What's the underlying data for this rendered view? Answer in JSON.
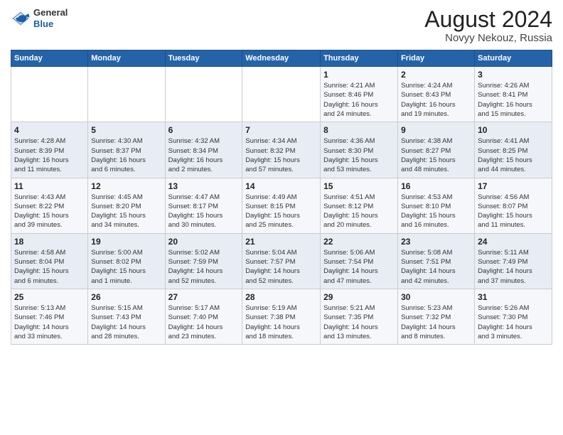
{
  "header": {
    "logo_general": "General",
    "logo_blue": "Blue",
    "month_year": "August 2024",
    "location": "Novyy Nekouz, Russia"
  },
  "days_of_week": [
    "Sunday",
    "Monday",
    "Tuesday",
    "Wednesday",
    "Thursday",
    "Friday",
    "Saturday"
  ],
  "weeks": [
    [
      {
        "day": "",
        "info": ""
      },
      {
        "day": "",
        "info": ""
      },
      {
        "day": "",
        "info": ""
      },
      {
        "day": "",
        "info": ""
      },
      {
        "day": "1",
        "info": "Sunrise: 4:21 AM\nSunset: 8:46 PM\nDaylight: 16 hours\nand 24 minutes."
      },
      {
        "day": "2",
        "info": "Sunrise: 4:24 AM\nSunset: 8:43 PM\nDaylight: 16 hours\nand 19 minutes."
      },
      {
        "day": "3",
        "info": "Sunrise: 4:26 AM\nSunset: 8:41 PM\nDaylight: 16 hours\nand 15 minutes."
      }
    ],
    [
      {
        "day": "4",
        "info": "Sunrise: 4:28 AM\nSunset: 8:39 PM\nDaylight: 16 hours\nand 11 minutes."
      },
      {
        "day": "5",
        "info": "Sunrise: 4:30 AM\nSunset: 8:37 PM\nDaylight: 16 hours\nand 6 minutes."
      },
      {
        "day": "6",
        "info": "Sunrise: 4:32 AM\nSunset: 8:34 PM\nDaylight: 16 hours\nand 2 minutes."
      },
      {
        "day": "7",
        "info": "Sunrise: 4:34 AM\nSunset: 8:32 PM\nDaylight: 15 hours\nand 57 minutes."
      },
      {
        "day": "8",
        "info": "Sunrise: 4:36 AM\nSunset: 8:30 PM\nDaylight: 15 hours\nand 53 minutes."
      },
      {
        "day": "9",
        "info": "Sunrise: 4:38 AM\nSunset: 8:27 PM\nDaylight: 15 hours\nand 48 minutes."
      },
      {
        "day": "10",
        "info": "Sunrise: 4:41 AM\nSunset: 8:25 PM\nDaylight: 15 hours\nand 44 minutes."
      }
    ],
    [
      {
        "day": "11",
        "info": "Sunrise: 4:43 AM\nSunset: 8:22 PM\nDaylight: 15 hours\nand 39 minutes."
      },
      {
        "day": "12",
        "info": "Sunrise: 4:45 AM\nSunset: 8:20 PM\nDaylight: 15 hours\nand 34 minutes."
      },
      {
        "day": "13",
        "info": "Sunrise: 4:47 AM\nSunset: 8:17 PM\nDaylight: 15 hours\nand 30 minutes."
      },
      {
        "day": "14",
        "info": "Sunrise: 4:49 AM\nSunset: 8:15 PM\nDaylight: 15 hours\nand 25 minutes."
      },
      {
        "day": "15",
        "info": "Sunrise: 4:51 AM\nSunset: 8:12 PM\nDaylight: 15 hours\nand 20 minutes."
      },
      {
        "day": "16",
        "info": "Sunrise: 4:53 AM\nSunset: 8:10 PM\nDaylight: 15 hours\nand 16 minutes."
      },
      {
        "day": "17",
        "info": "Sunrise: 4:56 AM\nSunset: 8:07 PM\nDaylight: 15 hours\nand 11 minutes."
      }
    ],
    [
      {
        "day": "18",
        "info": "Sunrise: 4:58 AM\nSunset: 8:04 PM\nDaylight: 15 hours\nand 6 minutes."
      },
      {
        "day": "19",
        "info": "Sunrise: 5:00 AM\nSunset: 8:02 PM\nDaylight: 15 hours\nand 1 minute."
      },
      {
        "day": "20",
        "info": "Sunrise: 5:02 AM\nSunset: 7:59 PM\nDaylight: 14 hours\nand 52 minutes."
      },
      {
        "day": "21",
        "info": "Sunrise: 5:04 AM\nSunset: 7:57 PM\nDaylight: 14 hours\nand 52 minutes."
      },
      {
        "day": "22",
        "info": "Sunrise: 5:06 AM\nSunset: 7:54 PM\nDaylight: 14 hours\nand 47 minutes."
      },
      {
        "day": "23",
        "info": "Sunrise: 5:08 AM\nSunset: 7:51 PM\nDaylight: 14 hours\nand 42 minutes."
      },
      {
        "day": "24",
        "info": "Sunrise: 5:11 AM\nSunset: 7:49 PM\nDaylight: 14 hours\nand 37 minutes."
      }
    ],
    [
      {
        "day": "25",
        "info": "Sunrise: 5:13 AM\nSunset: 7:46 PM\nDaylight: 14 hours\nand 33 minutes."
      },
      {
        "day": "26",
        "info": "Sunrise: 5:15 AM\nSunset: 7:43 PM\nDaylight: 14 hours\nand 28 minutes."
      },
      {
        "day": "27",
        "info": "Sunrise: 5:17 AM\nSunset: 7:40 PM\nDaylight: 14 hours\nand 23 minutes."
      },
      {
        "day": "28",
        "info": "Sunrise: 5:19 AM\nSunset: 7:38 PM\nDaylight: 14 hours\nand 18 minutes."
      },
      {
        "day": "29",
        "info": "Sunrise: 5:21 AM\nSunset: 7:35 PM\nDaylight: 14 hours\nand 13 minutes."
      },
      {
        "day": "30",
        "info": "Sunrise: 5:23 AM\nSunset: 7:32 PM\nDaylight: 14 hours\nand 8 minutes."
      },
      {
        "day": "31",
        "info": "Sunrise: 5:26 AM\nSunset: 7:30 PM\nDaylight: 14 hours\nand 3 minutes."
      }
    ]
  ]
}
